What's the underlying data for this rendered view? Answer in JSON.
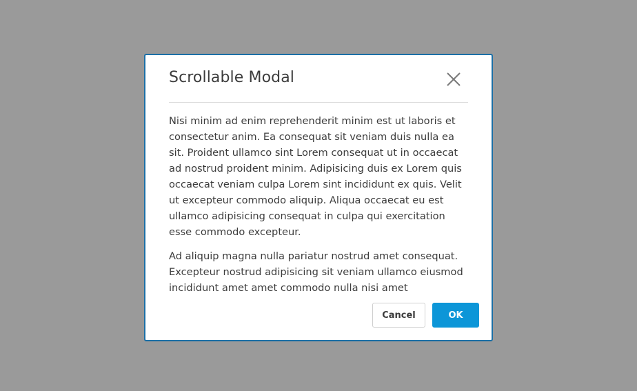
{
  "modal": {
    "title": "Scrollable Modal",
    "close_icon": "close-icon",
    "body_paragraphs": [
      "Nisi minim ad enim reprehenderit minim est ut laboris et consectetur anim. Ea consequat sit veniam duis nulla ea sit. Proident ullamco sint Lorem consequat ut in occaecat ad nostrud proident minim. Adipisicing duis ex Lorem quis occaecat veniam culpa Lorem sint incididunt ex quis. Velit ut excepteur commodo aliquip. Aliqua occaecat eu est ullamco adipisicing consequat in culpa qui exercitation esse commodo excepteur.",
      "Ad aliquip magna nulla pariatur nostrud amet consequat. Excepteur nostrud adipisicing sit veniam ullamco eiusmod incididunt amet amet commodo nulla nisi amet"
    ],
    "cancel_label": "Cancel",
    "ok_label": "OK"
  },
  "colors": {
    "overlay": "#9a9a9a",
    "modal_border": "#1b6fa6",
    "primary_button": "#0c96d8"
  }
}
